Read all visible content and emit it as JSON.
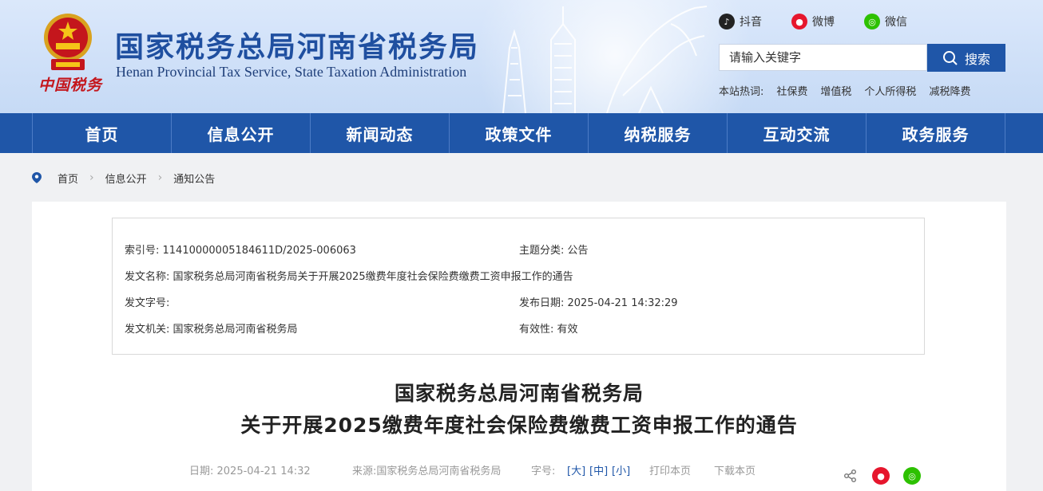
{
  "header": {
    "title": "国家税务总局河南省税务局",
    "subtitle": "Henan Provincial Tax Service, State Taxation Administration",
    "logo_script": "中国税务",
    "social": [
      {
        "label": "抖音",
        "icon": "douyin-icon",
        "color": "#222222"
      },
      {
        "label": "微博",
        "icon": "weibo-icon",
        "color": "#e6162d"
      },
      {
        "label": "微信",
        "icon": "wechat-icon",
        "color": "#2dc100"
      }
    ],
    "search": {
      "placeholder": "请输入关键字",
      "button_label": "搜索"
    },
    "hot": {
      "label": "本站热词:",
      "items": [
        "社保费",
        "增值税",
        "个人所得税",
        "减税降费"
      ]
    }
  },
  "nav": {
    "items": [
      "首页",
      "信息公开",
      "新闻动态",
      "政策文件",
      "纳税服务",
      "互动交流",
      "政务服务"
    ]
  },
  "breadcrumb": [
    "首页",
    "信息公开",
    "通知公告"
  ],
  "meta": {
    "index_no": "索引号:  11410000005184611D/2025-006063",
    "category": "主题分类:  公告",
    "doc_name": "发文名称:  国家税务总局河南省税务局关于开展2025缴费年度社会保险费缴费工资申报工作的通告",
    "doc_no": "发文字号:",
    "pub_date": "发布日期:  2025-04-21 14:32:29",
    "issuer": "发文机关:  国家税务总局河南省税务局",
    "validity": "有效性:  有效"
  },
  "article": {
    "title_line1": "国家税务总局河南省税务局",
    "title_line2": "关于开展2025缴费年度社会保险费缴费工资申报工作的通告"
  },
  "toolbar": {
    "date": "日期:  2025-04-21 14:32",
    "source": "来源:国家税务总局河南省税务局",
    "font_label": "字号:",
    "size_large": "[大]",
    "size_medium": "[中]",
    "size_small": "[小]",
    "print": "打印本页",
    "download": "下载本页"
  },
  "colors": {
    "primary": "#1f56a8",
    "title_blue": "#1f4fa0",
    "emblem_red": "#c4161c"
  }
}
